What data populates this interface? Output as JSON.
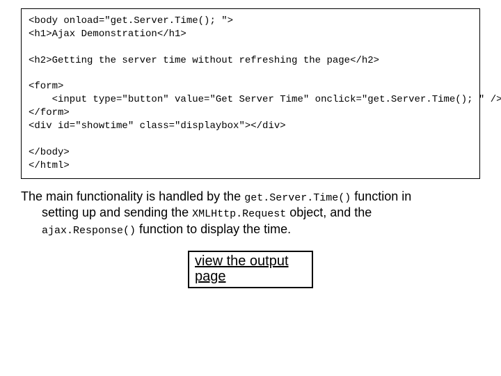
{
  "code": {
    "l1": "<body onload=\"get.Server.Time(); \">",
    "l2": "<h1>Ajax Demonstration</h1>",
    "l3": "<h2>Getting the server time without refreshing the page</h2>",
    "l4": "<form>",
    "l5": "    <input type=\"button\" value=\"Get Server Time\" onclick=\"get.Server.Time(); \" />",
    "l6": "</form>",
    "l7": "<div id=\"showtime\" class=\"displaybox\"></div>",
    "l8": "</body>",
    "l9": "</html>"
  },
  "prose": {
    "p1a": "The main functionality is handled by the ",
    "p1b": "get.Server.Time()",
    "p1c": " function in",
    "p2a": "setting up and sending the ",
    "p2b": "XMLHttp.Request",
    "p2c": " object, and the",
    "p3a": "ajax.Response()",
    "p3b": " function to display the time."
  },
  "link": {
    "label": "view the output page"
  }
}
